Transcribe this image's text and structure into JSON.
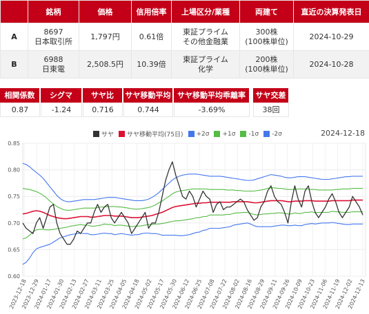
{
  "table": {
    "headers": [
      "",
      "銘柄",
      "価格",
      "信用倍率",
      "上場区分/業種",
      "両建て",
      "直近の決算発表日"
    ],
    "rows": [
      {
        "key": "A",
        "code": "8697",
        "name": "日本取引所",
        "price": "1,797円",
        "ratio": "0.61倍",
        "market": "東証プライム",
        "sector": "その他金融業",
        "qty": "300株",
        "unit": "(100株単位)",
        "date": "2024-10-29"
      },
      {
        "key": "B",
        "code": "6988",
        "name": "日東電",
        "price": "2,508.5円",
        "ratio": "10.39倍",
        "market": "東証プライム",
        "sector": "化学",
        "qty": "200株",
        "unit": "(100株単位)",
        "date": "2024-10-28"
      }
    ]
  },
  "stats": [
    {
      "label": "相関係数",
      "value": "0.87"
    },
    {
      "label": "シグマ",
      "value": "-1.24"
    },
    {
      "label": "サヤ比",
      "value": "0.716"
    },
    {
      "label": "サヤ移動平均",
      "value": "0.744"
    },
    {
      "label": "サヤ移動平均乖離率",
      "value": "-3.69%"
    },
    {
      "label": "サヤ交差",
      "value": "38回"
    }
  ],
  "chart_header": {
    "date": "2024-12-18",
    "legend": [
      {
        "label": "サヤ",
        "color": "#333333"
      },
      {
        "label": "サヤ移動平均(75日)",
        "color": "#dd1133"
      },
      {
        "label": "+2σ",
        "color": "#4477ee"
      },
      {
        "label": "+1σ",
        "color": "#55bb44"
      },
      {
        "label": "-1σ",
        "color": "#55bb44"
      },
      {
        "label": "-2σ",
        "color": "#4477ee"
      }
    ]
  },
  "chart_data": {
    "type": "line",
    "ylim": [
      0.6,
      0.85
    ],
    "yticks": [
      "0.85",
      "0.80",
      "0.75",
      "0.70",
      "0.65",
      "0.60"
    ],
    "xticks": [
      "2023-12-18",
      "2023-12-29",
      "2024-01-17",
      "2024-01-30",
      "2024-02-13",
      "2024-02-27",
      "2024-03-11",
      "2024-03-25",
      "2024-04-05",
      "2024-04-18",
      "2024-05-02",
      "2024-05-17",
      "2024-05-30",
      "2024-06-12",
      "2024-06-25",
      "2024-07-08",
      "2024-07-22",
      "2024-08-02",
      "2024-08-16",
      "2024-08-29",
      "2024-09-11",
      "2024-09-26",
      "2024-10-09",
      "2024-10-23",
      "2024-11-06",
      "2024-11-19",
      "2024-12-02",
      "2024-12-13"
    ],
    "series": [
      {
        "name": "サヤ",
        "color": "#333333",
        "values": [
          0.7,
          0.69,
          0.685,
          0.68,
          0.7,
          0.71,
          0.69,
          0.71,
          0.73,
          0.735,
          0.7,
          0.68,
          0.67,
          0.66,
          0.66,
          0.67,
          0.685,
          0.68,
          0.69,
          0.7,
          0.7,
          0.72,
          0.735,
          0.72,
          0.73,
          0.735,
          0.71,
          0.7,
          0.71,
          0.72,
          0.71,
          0.7,
          0.68,
          0.69,
          0.7,
          0.71,
          0.72,
          0.69,
          0.7,
          0.7,
          0.72,
          0.75,
          0.78,
          0.8,
          0.815,
          0.79,
          0.77,
          0.75,
          0.745,
          0.76,
          0.75,
          0.73,
          0.745,
          0.76,
          0.75,
          0.745,
          0.72,
          0.735,
          0.74,
          0.725,
          0.73,
          0.73,
          0.735,
          0.74,
          0.745,
          0.74,
          0.725,
          0.715,
          0.705,
          0.71,
          0.73,
          0.74,
          0.76,
          0.77,
          0.75,
          0.74,
          0.735,
          0.72,
          0.7,
          0.74,
          0.77,
          0.745,
          0.73,
          0.76,
          0.77,
          0.74,
          0.72,
          0.71,
          0.72,
          0.73,
          0.745,
          0.755,
          0.74,
          0.72,
          0.71,
          0.72,
          0.73,
          0.75,
          0.74,
          0.73,
          0.715
        ]
      },
      {
        "name": "サヤ移動平均(75日)",
        "color": "#dd1133",
        "values": [
          0.717,
          0.718,
          0.72,
          0.722,
          0.723,
          0.722,
          0.72,
          0.717,
          0.714,
          0.712,
          0.71,
          0.709,
          0.708,
          0.708,
          0.709,
          0.71,
          0.711,
          0.712,
          0.712,
          0.712,
          0.711,
          0.711,
          0.712,
          0.713,
          0.714,
          0.714,
          0.714,
          0.713,
          0.713,
          0.713,
          0.712,
          0.711,
          0.71,
          0.71,
          0.71,
          0.711,
          0.712,
          0.713,
          0.714,
          0.716,
          0.718,
          0.72,
          0.723,
          0.726,
          0.729,
          0.731,
          0.732,
          0.733,
          0.734,
          0.735,
          0.736,
          0.737,
          0.737,
          0.738,
          0.738,
          0.739,
          0.739,
          0.739,
          0.739,
          0.739,
          0.739,
          0.739,
          0.74,
          0.74,
          0.74,
          0.74,
          0.74,
          0.739,
          0.738,
          0.738,
          0.739,
          0.74,
          0.741,
          0.742,
          0.742,
          0.742,
          0.742,
          0.741,
          0.74,
          0.74,
          0.741,
          0.741,
          0.741,
          0.742,
          0.742,
          0.742,
          0.741,
          0.741,
          0.741,
          0.741,
          0.741,
          0.742,
          0.742,
          0.742,
          0.742,
          0.742,
          0.742,
          0.743,
          0.743,
          0.743,
          0.743
        ]
      },
      {
        "name": "+2σ",
        "color": "#4477ee",
        "values": [
          0.812,
          0.81,
          0.806,
          0.8,
          0.795,
          0.79,
          0.784,
          0.776,
          0.768,
          0.76,
          0.752,
          0.746,
          0.742,
          0.74,
          0.74,
          0.741,
          0.742,
          0.743,
          0.744,
          0.744,
          0.744,
          0.744,
          0.745,
          0.746,
          0.747,
          0.748,
          0.748,
          0.748,
          0.747,
          0.746,
          0.745,
          0.744,
          0.743,
          0.742,
          0.742,
          0.742,
          0.743,
          0.745,
          0.748,
          0.752,
          0.757,
          0.763,
          0.769,
          0.775,
          0.781,
          0.785,
          0.788,
          0.79,
          0.791,
          0.792,
          0.792,
          0.792,
          0.791,
          0.79,
          0.789,
          0.788,
          0.788,
          0.788,
          0.788,
          0.787,
          0.786,
          0.785,
          0.784,
          0.783,
          0.782,
          0.781,
          0.78,
          0.78,
          0.781,
          0.783,
          0.785,
          0.787,
          0.789,
          0.791,
          0.79,
          0.789,
          0.788,
          0.786,
          0.785,
          0.785,
          0.786,
          0.787,
          0.787,
          0.787,
          0.786,
          0.785,
          0.784,
          0.783,
          0.782,
          0.782,
          0.782,
          0.783,
          0.784,
          0.785,
          0.786,
          0.787,
          0.787,
          0.788,
          0.788,
          0.788,
          0.788
        ]
      },
      {
        "name": "+1σ",
        "color": "#55bb44",
        "values": [
          0.765,
          0.764,
          0.763,
          0.761,
          0.759,
          0.756,
          0.752,
          0.747,
          0.741,
          0.736,
          0.731,
          0.728,
          0.725,
          0.724,
          0.724,
          0.725,
          0.726,
          0.727,
          0.728,
          0.728,
          0.728,
          0.728,
          0.729,
          0.73,
          0.73,
          0.731,
          0.731,
          0.731,
          0.73,
          0.73,
          0.729,
          0.728,
          0.727,
          0.726,
          0.726,
          0.727,
          0.728,
          0.729,
          0.731,
          0.734,
          0.738,
          0.741,
          0.746,
          0.75,
          0.755,
          0.758,
          0.76,
          0.761,
          0.762,
          0.763,
          0.764,
          0.764,
          0.764,
          0.764,
          0.764,
          0.763,
          0.763,
          0.763,
          0.763,
          0.763,
          0.762,
          0.762,
          0.762,
          0.761,
          0.761,
          0.76,
          0.76,
          0.76,
          0.76,
          0.761,
          0.762,
          0.763,
          0.765,
          0.766,
          0.766,
          0.765,
          0.765,
          0.764,
          0.763,
          0.763,
          0.763,
          0.764,
          0.764,
          0.764,
          0.764,
          0.763,
          0.763,
          0.762,
          0.762,
          0.762,
          0.762,
          0.762,
          0.763,
          0.763,
          0.764,
          0.764,
          0.764,
          0.765,
          0.765,
          0.765,
          0.765
        ]
      },
      {
        "name": "-1σ",
        "color": "#55bb44",
        "values": [
          0.67,
          0.672,
          0.677,
          0.683,
          0.687,
          0.688,
          0.688,
          0.687,
          0.687,
          0.688,
          0.689,
          0.69,
          0.691,
          0.692,
          0.694,
          0.695,
          0.696,
          0.697,
          0.696,
          0.696,
          0.694,
          0.694,
          0.695,
          0.696,
          0.698,
          0.697,
          0.697,
          0.695,
          0.696,
          0.696,
          0.695,
          0.694,
          0.693,
          0.694,
          0.694,
          0.695,
          0.696,
          0.697,
          0.697,
          0.698,
          0.698,
          0.699,
          0.7,
          0.702,
          0.703,
          0.704,
          0.704,
          0.705,
          0.706,
          0.707,
          0.708,
          0.71,
          0.71,
          0.712,
          0.712,
          0.715,
          0.715,
          0.715,
          0.715,
          0.715,
          0.716,
          0.716,
          0.718,
          0.719,
          0.719,
          0.72,
          0.72,
          0.718,
          0.716,
          0.715,
          0.716,
          0.717,
          0.717,
          0.718,
          0.718,
          0.719,
          0.719,
          0.718,
          0.717,
          0.717,
          0.719,
          0.718,
          0.718,
          0.72,
          0.72,
          0.721,
          0.719,
          0.72,
          0.72,
          0.72,
          0.72,
          0.722,
          0.721,
          0.721,
          0.72,
          0.72,
          0.72,
          0.721,
          0.721,
          0.721,
          0.721
        ]
      },
      {
        "name": "-2σ",
        "color": "#4477ee",
        "values": [
          0.622,
          0.626,
          0.634,
          0.644,
          0.651,
          0.654,
          0.656,
          0.658,
          0.66,
          0.664,
          0.668,
          0.672,
          0.674,
          0.676,
          0.678,
          0.679,
          0.68,
          0.681,
          0.68,
          0.68,
          0.678,
          0.678,
          0.679,
          0.68,
          0.681,
          0.68,
          0.68,
          0.678,
          0.679,
          0.68,
          0.679,
          0.678,
          0.677,
          0.678,
          0.678,
          0.68,
          0.681,
          0.681,
          0.68,
          0.68,
          0.679,
          0.677,
          0.677,
          0.677,
          0.677,
          0.677,
          0.676,
          0.676,
          0.677,
          0.678,
          0.68,
          0.682,
          0.683,
          0.686,
          0.687,
          0.69,
          0.69,
          0.69,
          0.69,
          0.691,
          0.692,
          0.693,
          0.696,
          0.697,
          0.698,
          0.699,
          0.7,
          0.698,
          0.695,
          0.693,
          0.693,
          0.693,
          0.693,
          0.693,
          0.694,
          0.695,
          0.696,
          0.696,
          0.695,
          0.695,
          0.696,
          0.695,
          0.695,
          0.697,
          0.698,
          0.699,
          0.698,
          0.699,
          0.7,
          0.7,
          0.7,
          0.701,
          0.7,
          0.699,
          0.698,
          0.697,
          0.697,
          0.698,
          0.698,
          0.698,
          0.698
        ]
      }
    ]
  }
}
